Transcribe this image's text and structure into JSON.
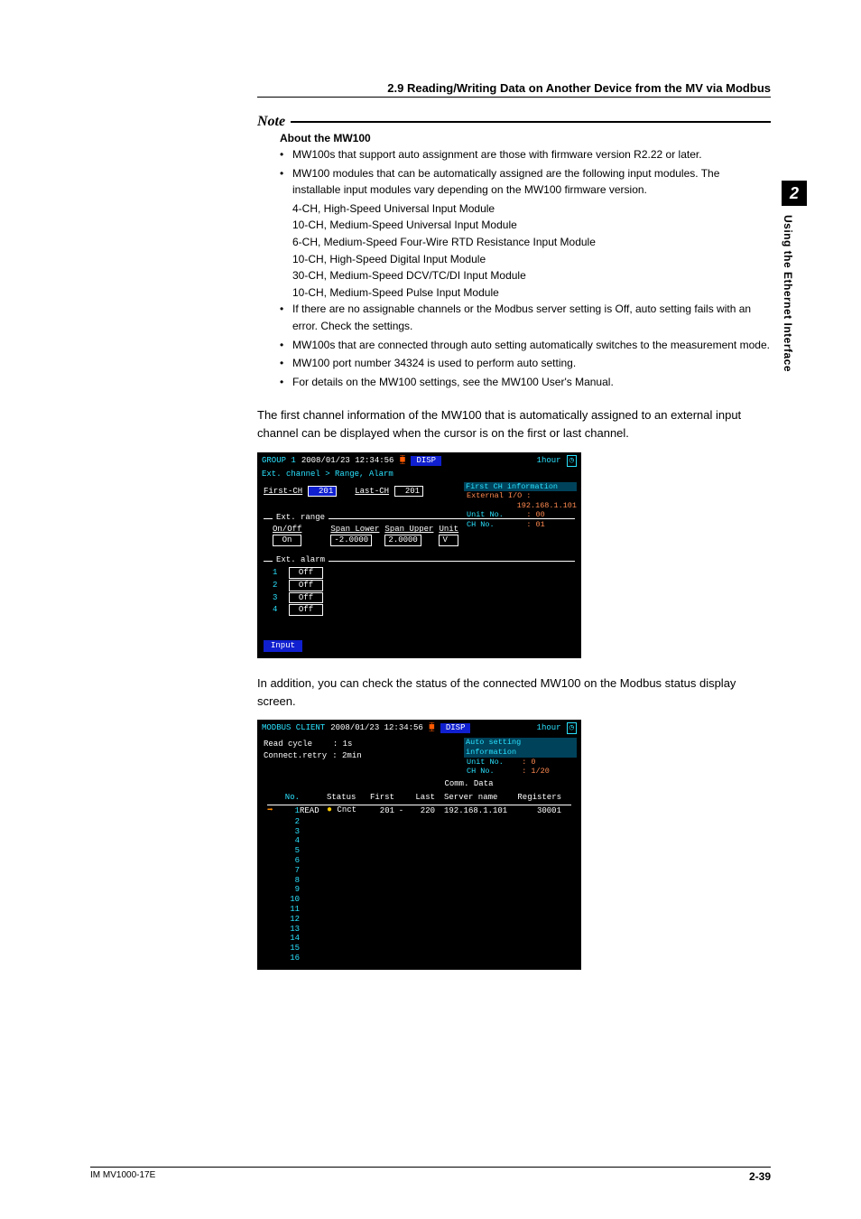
{
  "header": {
    "section": "2.9  Reading/Writing Data on Another Device from the MV via Modbus"
  },
  "side": {
    "chapter": "2",
    "title": "Using the Ethernet Interface"
  },
  "note": {
    "label": "Note",
    "subtitle": "About the MW100",
    "bullets": {
      "b1": "MW100s that support auto assignment are those with firmware version R2.22 or later.",
      "b2a": "MW100 modules that can be automatically assigned are the following input modules. The installable input modules vary depending on the MW100 firmware version.",
      "m1": "4-CH, High-Speed Universal Input Module",
      "m2": "10-CH, Medium-Speed Universal Input Module",
      "m3": "6-CH, Medium-Speed Four-Wire RTD Resistance Input Module",
      "m4": "10-CH, High-Speed Digital Input Module",
      "m5": "30-CH, Medium-Speed DCV/TC/DI Input Module",
      "m6": "10-CH, Medium-Speed Pulse Input Module",
      "b3": "If there are no assignable channels or the Modbus server setting is Off, auto setting fails with an error. Check the settings.",
      "b4": "MW100s that are connected through auto setting automatically switches to the measurement mode.",
      "b5": "MW100 port number 34324 is used to perform auto setting.",
      "b6": "For details on the MW100 settings, see the MW100 User's Manual."
    }
  },
  "para1": "The first channel information of the MW100 that is automatically assigned to an external input channel can be displayed when the cursor is on the first or last channel.",
  "para2": "In addition, you can check the status of the connected MW100 on the Modbus status display screen.",
  "sc1": {
    "group": "GROUP 1",
    "datetime": "2008/01/23 12:34:56",
    "disp": "DISP",
    "duration": "1hour",
    "breadcrumb": "Ext. channel > Range, Alarm",
    "first_ch_lbl": "First-CH",
    "first_ch_val": "201",
    "last_ch_lbl": "Last-CH",
    "last_ch_val": "201",
    "info_title": "First CH information",
    "info_ext": "External I/O :",
    "info_ip": "192.168.1.101",
    "info_unit_lbl": "Unit No.",
    "info_unit_val": ": 00",
    "info_ch_lbl": "CH No.",
    "info_ch_val": ": 01",
    "ext_range": "Ext. range",
    "onoff_lbl": "On/Off",
    "onoff_val": "On",
    "spanl_lbl": "Span Lower",
    "spanl_val": "-2.0000",
    "spanu_lbl": "Span Upper",
    "spanu_val": "2.0000",
    "unit_lbl": "Unit",
    "unit_val": "V",
    "ext_alarm": "Ext. alarm",
    "alarm_off": "Off",
    "input_btn": "Input"
  },
  "sc2": {
    "title": "MODBUS CLIENT",
    "datetime": "2008/01/23 12:34:56",
    "disp": "DISP",
    "duration": "1hour",
    "read_cycle_lbl": "Read cycle",
    "read_cycle_val": ": 1s",
    "retry_lbl": "Connect.retry",
    "retry_val": ": 2min",
    "info_title": "Auto setting information",
    "info_unit_lbl": "Unit No.",
    "info_unit_val": ": 0",
    "info_ch_lbl": "CH No.",
    "info_ch_val": ": 1/20",
    "hdr_comm": "Comm. Data",
    "hdr_no": "No.",
    "hdr_status": "Status",
    "hdr_first": "First",
    "hdr_last": "Last",
    "hdr_server": "Server name",
    "hdr_reg": "Registers",
    "row1": {
      "no": "1",
      "rw": "READ",
      "st": "Cnct",
      "first": "201",
      "last": "220",
      "server": "192.168.1.101",
      "reg": "30001"
    },
    "rows": [
      "2",
      "3",
      "4",
      "5",
      "6",
      "7",
      "8",
      "9",
      "10",
      "11",
      "12",
      "13",
      "14",
      "15",
      "16"
    ]
  },
  "footer": {
    "doc": "IM MV1000-17E",
    "page": "2-39"
  }
}
